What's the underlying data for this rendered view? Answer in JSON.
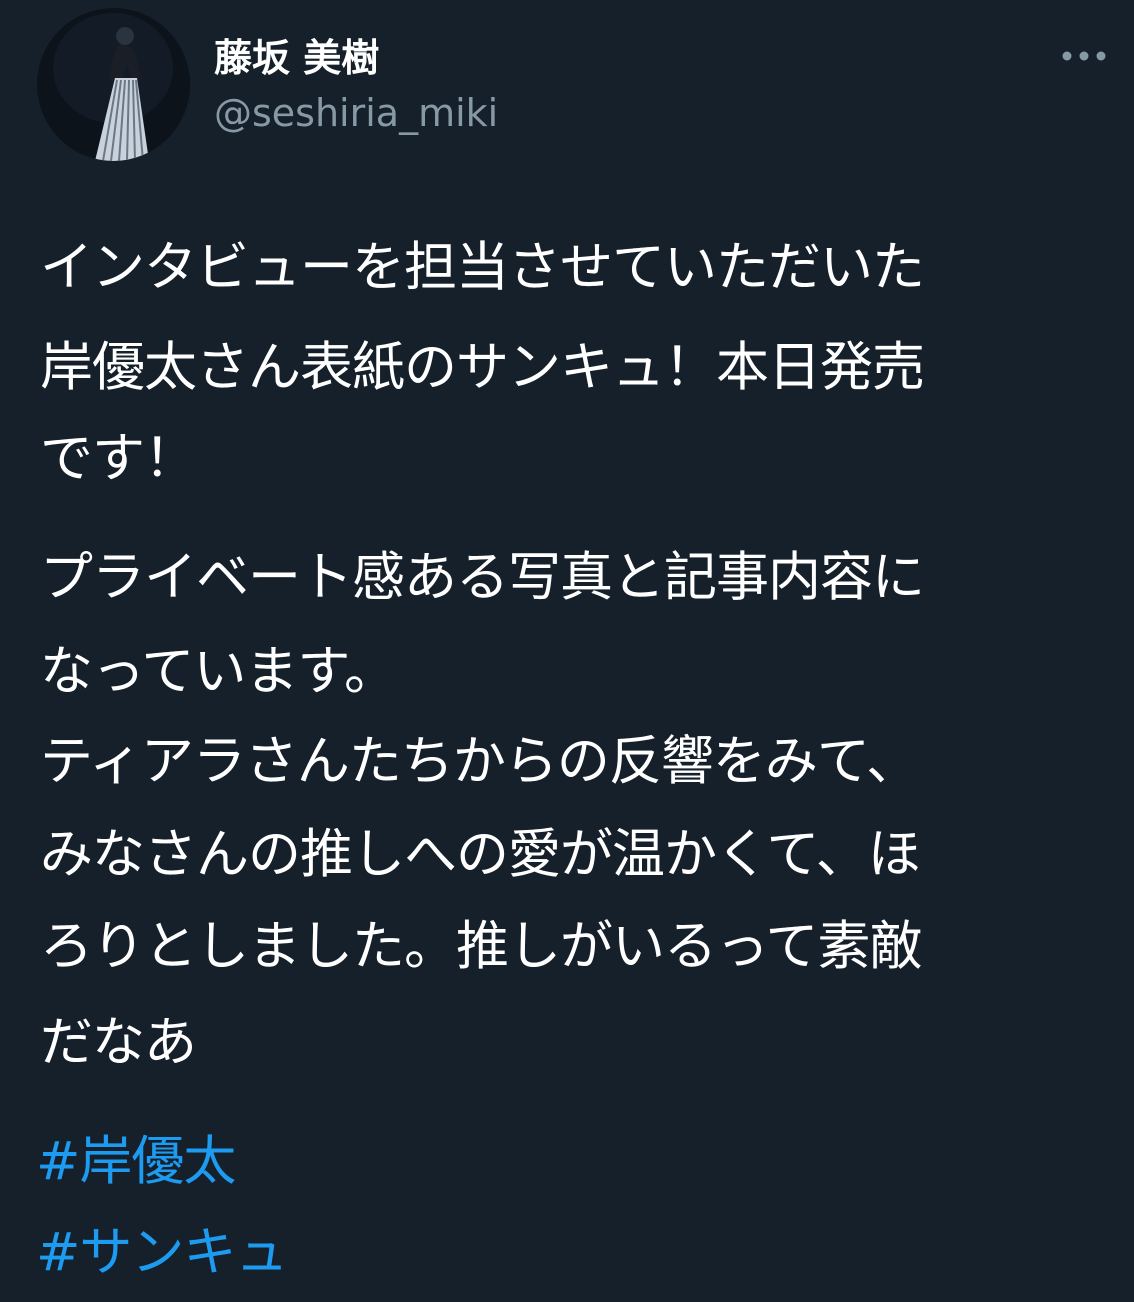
{
  "author": {
    "display_name": "藤坂 美樹",
    "handle": "@seshiria_miki"
  },
  "more_icon": "more-horizontal-icon",
  "paragraphs": [
    [
      "インタビューを担当させていただいた",
      "岸優太さん表紙のサンキュ！本日発売",
      "です！"
    ],
    [
      "プライベート感ある写真と記事内容に",
      "なっています。",
      "ティアラさんたちからの反響をみて、",
      "みなさんの推しへの愛が温かくて、ほ",
      "ろりとしました。推しがいるって素敵",
      "だなあ"
    ]
  ],
  "hashtags": [
    "#岸優太",
    "#サンキュ"
  ],
  "colors": {
    "background": "#15202b",
    "text": "#ffffff",
    "secondary_text": "#8899a6",
    "link": "#1d9bf0"
  }
}
